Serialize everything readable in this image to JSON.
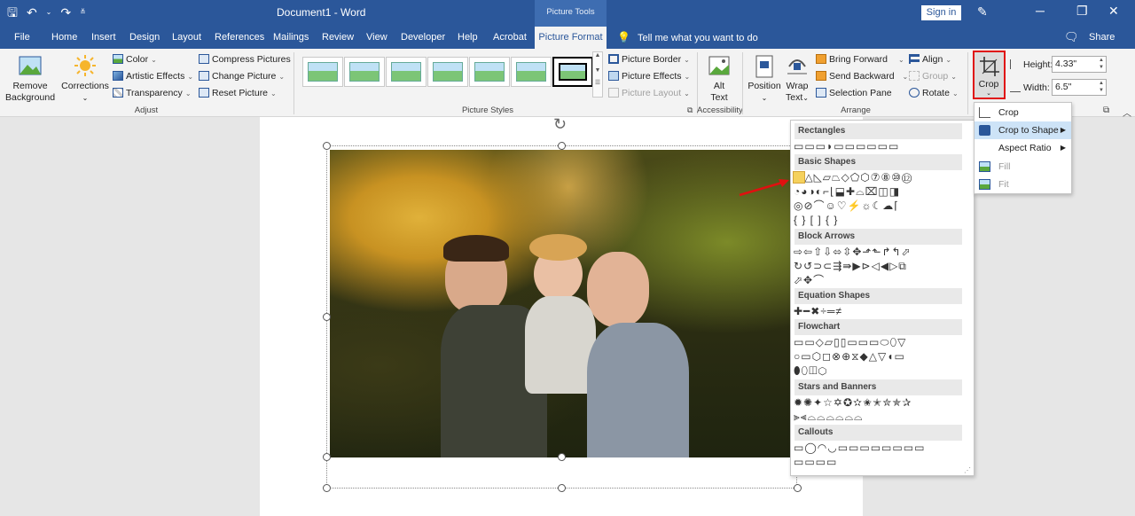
{
  "window": {
    "doc_title": "Document1  -  Word",
    "context_title": "Picture Tools",
    "signin_label": "Sign in"
  },
  "tabs": [
    {
      "label": "File"
    },
    {
      "label": "Home"
    },
    {
      "label": "Insert"
    },
    {
      "label": "Design"
    },
    {
      "label": "Layout"
    },
    {
      "label": "References"
    },
    {
      "label": "Mailings"
    },
    {
      "label": "Review"
    },
    {
      "label": "View"
    },
    {
      "label": "Developer"
    },
    {
      "label": "Help"
    },
    {
      "label": "Acrobat"
    },
    {
      "label": "Picture Format"
    }
  ],
  "tellme": "Tell me what you want to do",
  "share_label": "Share",
  "ribbon": {
    "remove_bg_line1": "Remove",
    "remove_bg_line2": "Background",
    "corrections": "Corrections",
    "color": "Color",
    "artistic_effects": "Artistic Effects",
    "transparency": "Transparency",
    "compress": "Compress Pictures",
    "change_picture": "Change Picture",
    "reset_picture": "Reset Picture",
    "group_adjust": "Adjust",
    "group_picture_styles": "Picture Styles",
    "picture_border": "Picture Border",
    "picture_effects": "Picture Effects",
    "picture_layout": "Picture Layout",
    "alt_line1": "Alt",
    "alt_line2": "Text",
    "group_accessibility": "Accessibility",
    "position": "Position",
    "wrap_line1": "Wrap",
    "wrap_line2": "Text",
    "bring_forward": "Bring Forward",
    "send_backward": "Send Backward",
    "selection_pane": "Selection Pane",
    "align": "Align",
    "group": "Group",
    "rotate": "Rotate",
    "group_arrange": "Arrange",
    "crop": "Crop",
    "height_label": "Height:",
    "height_value": "4.33\"",
    "width_label": "Width:",
    "width_value": "6.5\""
  },
  "shapes_panel": {
    "sections": [
      {
        "title": "Rectangles",
        "rows": [
          "▭▭▭◗▭▭▭▭▭▭"
        ]
      },
      {
        "title": "Basic Shapes",
        "rows": [
          "▭△◺▱⏢◇⬠⬡⑦⑧⑩⑫",
          "◔◕◑◐⌐⌊⬓✚⌓⌧◫◨",
          "◎⊘⌒☺♡⚡☼☾☁⌈",
          "{ }  [  ]   {   }"
        ]
      },
      {
        "title": "Block Arrows",
        "rows": [
          "⇨⇦⇧⇩⬄⇳✥⬏⬑↱↰⬀",
          "↻↺⊃⊂⇶⇛▶⊳◁◀▷⧉",
          "⬀✥⌒"
        ]
      },
      {
        "title": "Equation Shapes",
        "rows": [
          "✚━✖÷═≠"
        ]
      },
      {
        "title": "Flowchart",
        "rows": [
          "▭▭◇▱▯▯▭▭▭⬭⬯▽",
          "○▭⬡◻⊗⊕⧖◆△▽◖▭",
          "⬮⬯◫⬡"
        ]
      },
      {
        "title": "Stars and Banners",
        "rows": [
          "✹✺✦☆✡✪✫✬✭✮✯✰",
          "⫸⫷⌓⌓⌓⌓⌓⌓"
        ]
      },
      {
        "title": "Callouts",
        "rows": [
          "▭◯◠◡▭▭▭▭▭▭▭▭",
          "▭▭▭▭"
        ]
      }
    ]
  },
  "crop_menu": {
    "items": [
      {
        "label": "Crop"
      },
      {
        "label": "Crop to Shape"
      },
      {
        "label": "Aspect Ratio"
      },
      {
        "label": "Fill"
      },
      {
        "label": "Fit"
      }
    ]
  },
  "colors": {
    "accent": "#2b579a",
    "highlight": "#e01010",
    "hover": "#cde3f7"
  }
}
